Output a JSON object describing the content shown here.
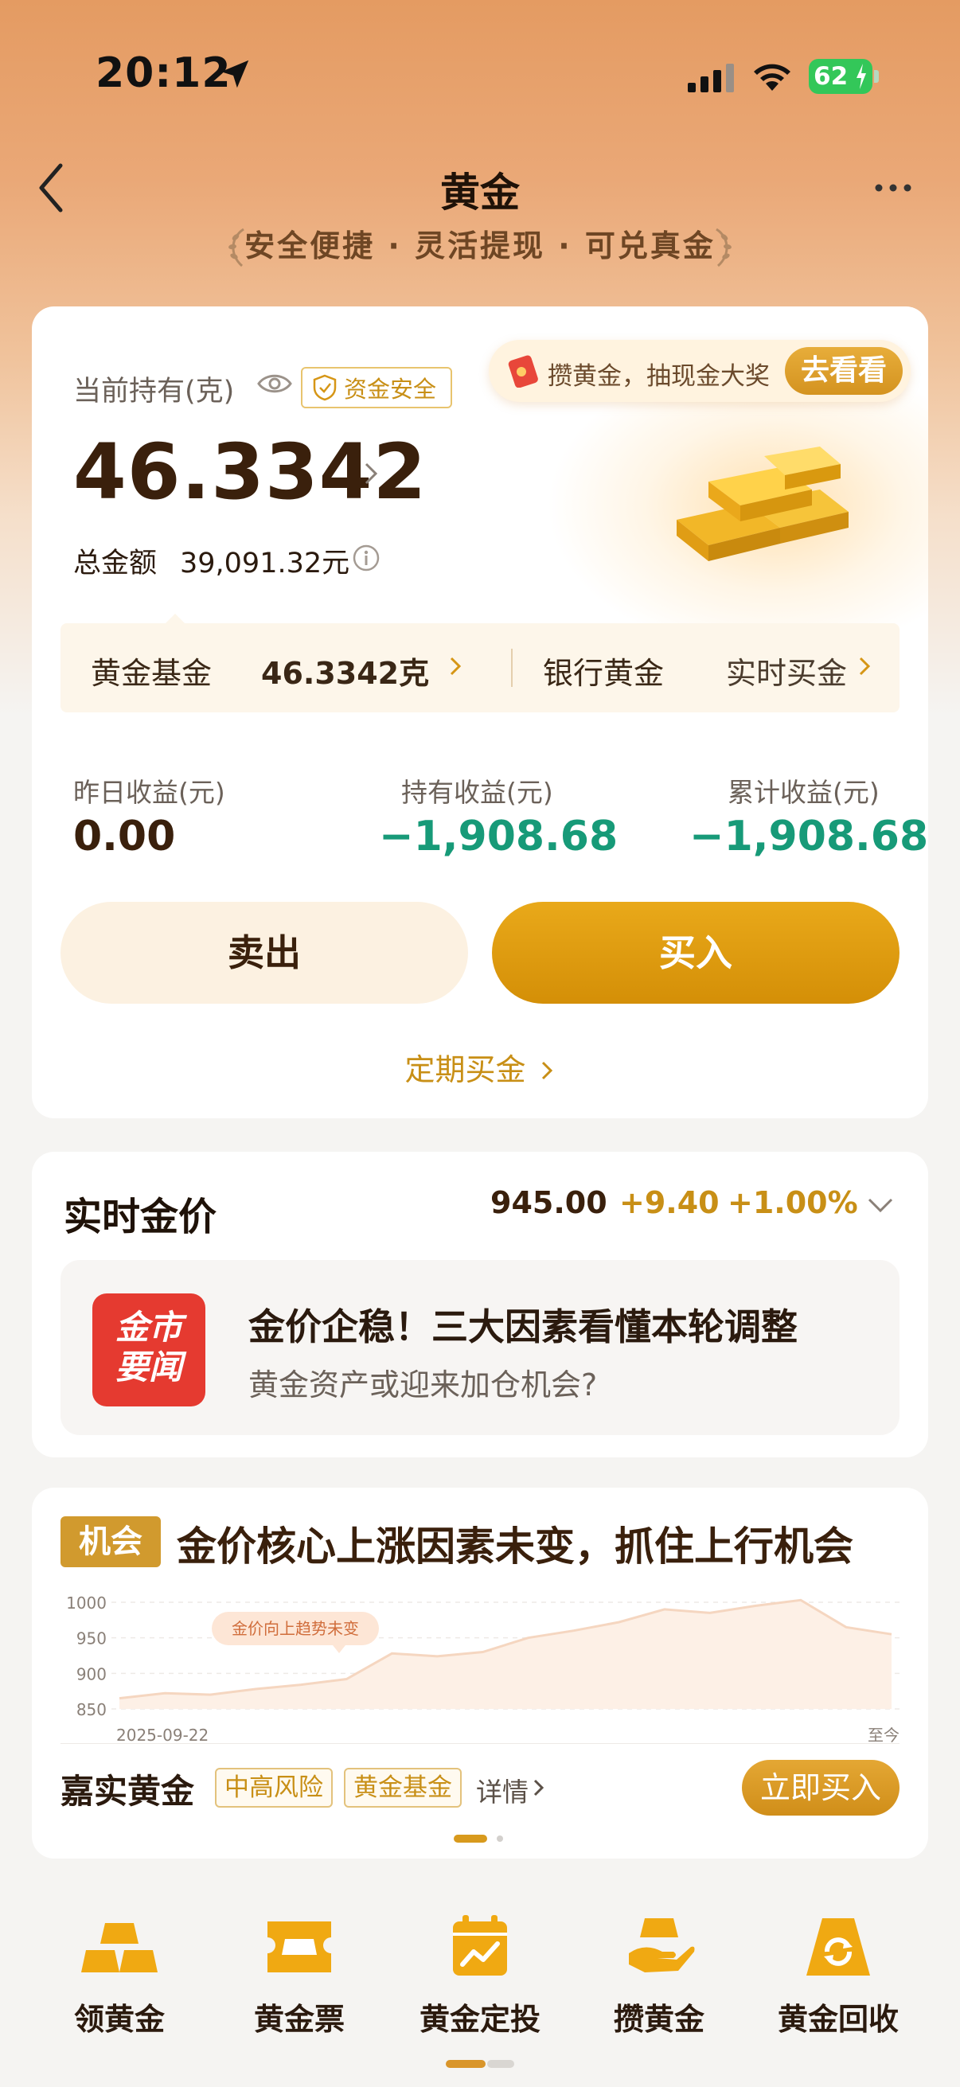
{
  "status_bar": {
    "time": "20:12",
    "battery": "62"
  },
  "header": {
    "title": "黄金",
    "slogan": "安全便捷 · 灵活提现 · 可兑真金"
  },
  "holdings": {
    "label": "当前持有(克)",
    "safe_badge": "资金安全",
    "promo_text": "攒黄金，抽现金大奖",
    "promo_button": "去看看",
    "amount": "46.3342",
    "total_label": "总金额",
    "total_value": "39,091.32元",
    "sub": {
      "fund_label": "黄金基金",
      "fund_value": "46.3342克",
      "bank_label": "银行黄金",
      "buy_label": "实时买金"
    },
    "stats": [
      {
        "label": "昨日收益(元)",
        "value": "0.00"
      },
      {
        "label": "持有收益(元)",
        "value": "−1,908.68"
      },
      {
        "label": "累计收益(元)",
        "value": "−1,908.68"
      }
    ],
    "sell_label": "卖出",
    "buy_label": "买入",
    "regular_buy": "定期买金"
  },
  "price": {
    "title": "实时金价",
    "value": "945.00",
    "change": "+9.40",
    "pct": "+1.00%",
    "news_logo_line1": "金市",
    "news_logo_line2": "要闻",
    "news_title": "金价企稳！三大因素看懂本轮调整",
    "news_sub": "黄金资产或迎来加仓机会?"
  },
  "opportunity": {
    "tag": "机会",
    "title": "金价核心上涨因素未变，抓住上行机会",
    "fund_name": "嘉实黄金",
    "risk_tag": "中高风险",
    "type_tag": "黄金基金",
    "detail": "详情",
    "buy_button": "立即买入"
  },
  "chart_data": {
    "type": "area",
    "x_start_label": "2025-09-22",
    "x_end_label": "至今",
    "yticks": [
      1000,
      950,
      900,
      850
    ],
    "ylim": [
      850,
      1000
    ],
    "annotation": "金价向上趋势未变",
    "values": [
      865,
      872,
      870,
      878,
      884,
      892,
      928,
      924,
      930,
      950,
      960,
      972,
      990,
      985,
      995,
      1003,
      965,
      955
    ]
  },
  "bottom_nav": [
    {
      "label": "领黄金",
      "icon": "gold-bars-icon"
    },
    {
      "label": "黄金票",
      "icon": "gold-ticket-icon"
    },
    {
      "label": "黄金定投",
      "icon": "calendar-chart-icon"
    },
    {
      "label": "攒黄金",
      "icon": "hand-gold-icon"
    },
    {
      "label": "黄金回收",
      "icon": "recycle-icon"
    }
  ],
  "colors": {
    "accent": "#d69616",
    "negative": "#179a78",
    "brand_red": "#e53a30"
  }
}
